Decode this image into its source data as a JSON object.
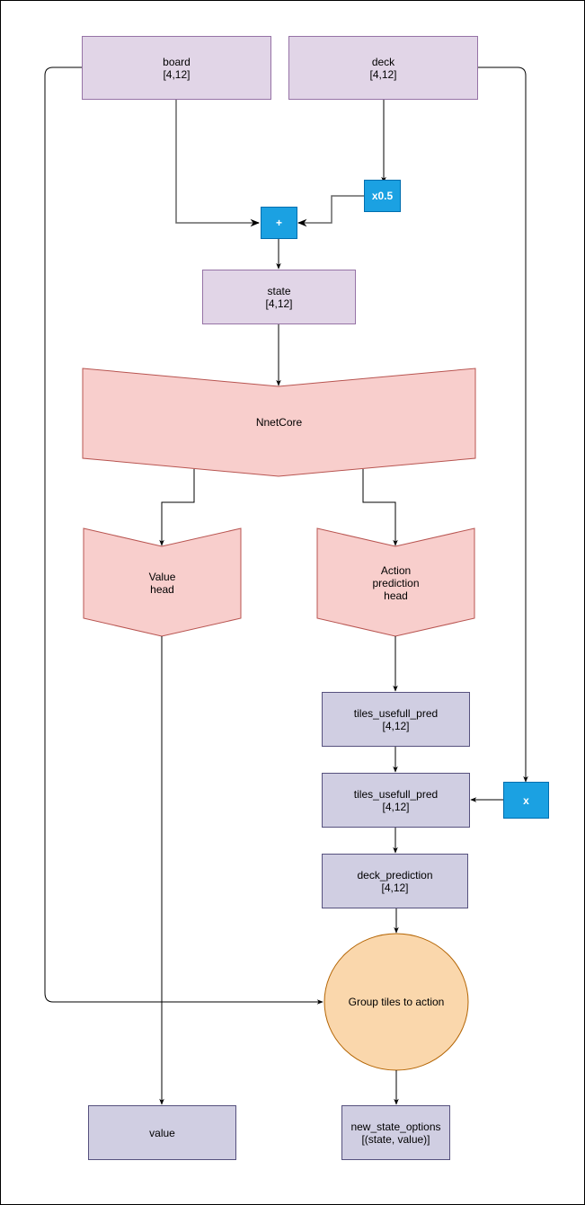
{
  "diagram": {
    "nodes": {
      "board": {
        "title": "board",
        "shape": "[4,12]"
      },
      "deck": {
        "title": "deck",
        "shape": "[4,12]"
      },
      "scale": {
        "label": "x0.5"
      },
      "add": {
        "label": "+"
      },
      "state": {
        "title": "state",
        "shape": "[4,12]"
      },
      "core": {
        "label": "NnetCore"
      },
      "value_head": {
        "label": "Value\nhead"
      },
      "action_head": {
        "label": "Action\nprediction\nhead"
      },
      "tiles_pred_1": {
        "title": "tiles_usefull_pred",
        "shape": "[4,12]"
      },
      "tiles_pred_2": {
        "title": "tiles_usefull_pred",
        "shape": "[4,12]"
      },
      "multiply": {
        "label": "x"
      },
      "deck_prediction": {
        "title": "deck_prediction",
        "shape": "[4,12]"
      },
      "group": {
        "label": "Group tiles to action"
      },
      "value": {
        "label": "value"
      },
      "new_state_options": {
        "title": "new_state_options",
        "shape": "[(state, value)]"
      }
    },
    "edges": [
      {
        "from": "board",
        "to": "add"
      },
      {
        "from": "deck",
        "to": "scale"
      },
      {
        "from": "scale",
        "to": "add"
      },
      {
        "from": "add",
        "to": "state"
      },
      {
        "from": "state",
        "to": "core"
      },
      {
        "from": "core",
        "to": "value_head"
      },
      {
        "from": "core",
        "to": "action_head"
      },
      {
        "from": "action_head",
        "to": "tiles_pred_1"
      },
      {
        "from": "tiles_pred_1",
        "to": "tiles_pred_2"
      },
      {
        "from": "deck",
        "to": "multiply"
      },
      {
        "from": "multiply",
        "to": "tiles_pred_2"
      },
      {
        "from": "tiles_pred_2",
        "to": "deck_prediction"
      },
      {
        "from": "deck_prediction",
        "to": "group"
      },
      {
        "from": "board",
        "to": "group"
      },
      {
        "from": "group",
        "to": "new_state_options"
      },
      {
        "from": "value_head",
        "to": "value"
      }
    ],
    "colors": {
      "input_fill": "#e1d5e7",
      "input_stroke": "#9673a6",
      "op_fill": "#1ba1e2",
      "net_fill": "#f8cecc",
      "net_stroke": "#b85450",
      "output_fill": "#d0cee2",
      "output_stroke": "#56517e",
      "group_fill": "#fad7ac",
      "group_stroke": "#b46504"
    }
  }
}
